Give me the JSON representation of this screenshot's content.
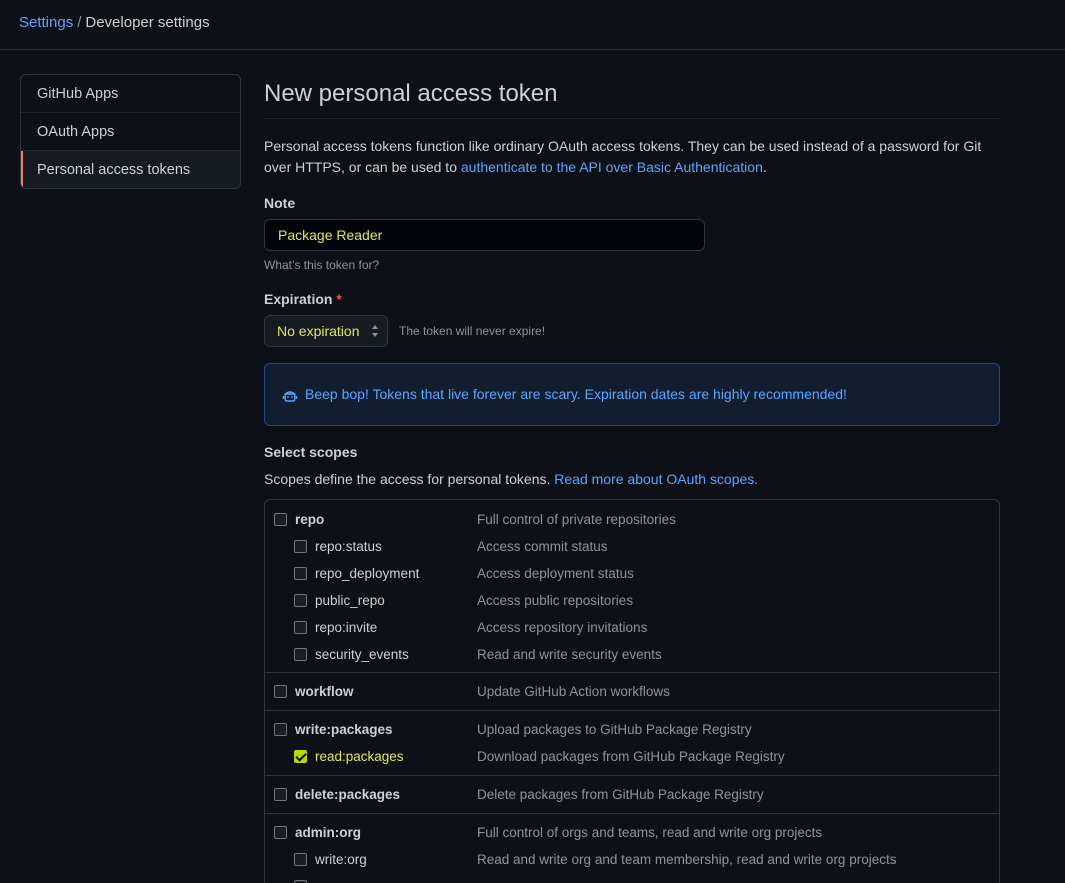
{
  "breadcrumb": {
    "root": "Settings",
    "separator": "/",
    "current": "Developer settings"
  },
  "sidebar": {
    "items": [
      {
        "label": "GitHub Apps"
      },
      {
        "label": "OAuth Apps"
      },
      {
        "label": "Personal access tokens"
      }
    ]
  },
  "page": {
    "title": "New personal access token",
    "intro_text": "Personal access tokens function like ordinary OAuth access tokens. They can be used instead of a password for Git over HTTPS, or can be used to ",
    "intro_link": "authenticate to the API over Basic Authentication",
    "intro_end": "."
  },
  "note": {
    "label": "Note",
    "value": "Package Reader",
    "hint": "What’s this token for?"
  },
  "expiration": {
    "label": "Expiration",
    "required_mark": "*",
    "selected": "No expiration",
    "note": "The token will never expire!"
  },
  "flash": {
    "message": "Beep bop! Tokens that live forever are scary. Expiration dates are highly recommended!"
  },
  "scopes": {
    "title": "Select scopes",
    "desc": "Scopes define the access for personal tokens. ",
    "desc_link": "Read more about OAuth scopes.",
    "groups": [
      {
        "name": "repo",
        "desc": "Full control of private repositories",
        "checked": false,
        "children": [
          {
            "name": "repo:status",
            "desc": "Access commit status",
            "checked": false
          },
          {
            "name": "repo_deployment",
            "desc": "Access deployment status",
            "checked": false
          },
          {
            "name": "public_repo",
            "desc": "Access public repositories",
            "checked": false
          },
          {
            "name": "repo:invite",
            "desc": "Access repository invitations",
            "checked": false
          },
          {
            "name": "security_events",
            "desc": "Read and write security events",
            "checked": false
          }
        ]
      },
      {
        "name": "workflow",
        "desc": "Update GitHub Action workflows",
        "checked": false,
        "children": []
      },
      {
        "name": "write:packages",
        "desc": "Upload packages to GitHub Package Registry",
        "checked": false,
        "children": [
          {
            "name": "read:packages",
            "desc": "Download packages from GitHub Package Registry",
            "checked": true
          }
        ]
      },
      {
        "name": "delete:packages",
        "desc": "Delete packages from GitHub Package Registry",
        "checked": false,
        "children": []
      },
      {
        "name": "admin:org",
        "desc": "Full control of orgs and teams, read and write org projects",
        "checked": false,
        "children": [
          {
            "name": "write:org",
            "desc": "Read and write org and team membership, read and write org projects",
            "checked": false
          }
        ]
      }
    ]
  },
  "colors": {
    "accent": "#58a6ff",
    "highlight": "#e3e75a",
    "checked": "#b5d800",
    "nav_indicator": "#f78166"
  }
}
